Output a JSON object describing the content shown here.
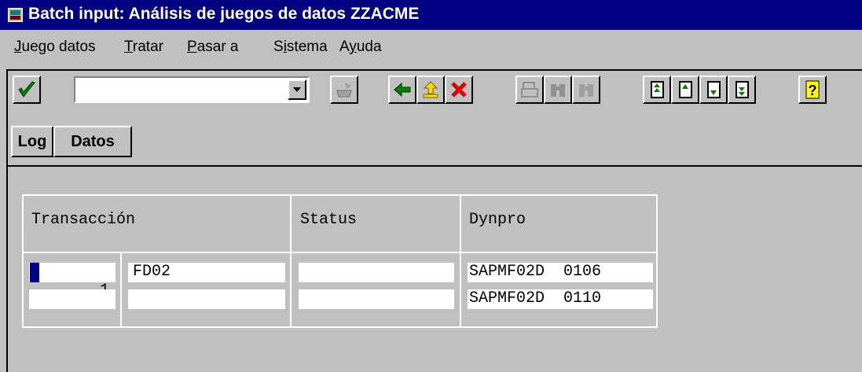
{
  "window": {
    "title": "Batch input: Análisis de juegos de datos ZZACME"
  },
  "menu": [
    {
      "label": "Juego datos",
      "u": "J",
      "rest": "uego datos"
    },
    {
      "label": "Tratar",
      "u": "T",
      "rest": "ratar"
    },
    {
      "label": "Pasar a",
      "u": "P",
      "rest": "asar a"
    },
    {
      "label": "Sistema",
      "pre": "S",
      "u": "i",
      "rest": "stema"
    },
    {
      "label": "Ayuda",
      "pre": "A",
      "u": "y",
      "rest": "uda"
    }
  ],
  "toolbar": {
    "command_value": "",
    "buttons": [
      "enter",
      "save",
      "back",
      "exit",
      "cancel",
      "print",
      "find",
      "find-next",
      "first-page",
      "previous-page",
      "next-page",
      "last-page",
      "help"
    ]
  },
  "app_toolbar": {
    "log_label": "Log",
    "datos_label": "Datos"
  },
  "table": {
    "headers": {
      "transaccion": "Transacción",
      "status": "Status",
      "dynpro": "Dynpro"
    },
    "rows": [
      {
        "number": "1",
        "transaction": "FD02",
        "status": "",
        "dynpro": "SAPMF02D  0106"
      },
      {
        "number": "",
        "transaction": "",
        "status": "",
        "dynpro": "SAPMF02D  0110"
      }
    ]
  },
  "colors": {
    "titlebar": "#000080",
    "background": "#c0c0c0",
    "cursor": "#000080"
  }
}
